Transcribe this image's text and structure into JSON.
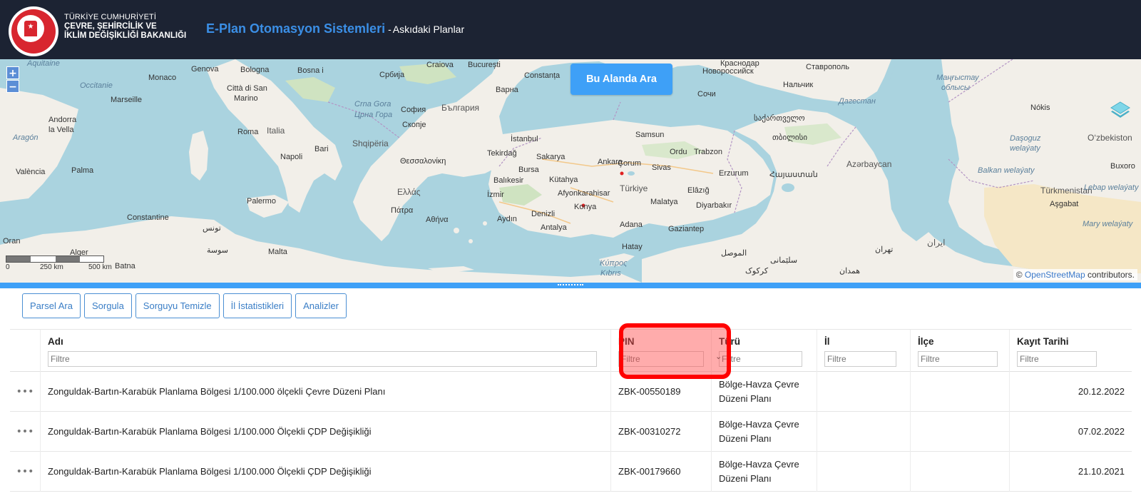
{
  "header": {
    "ministry_line1": "TÜRKİYE CUMHURİYETİ",
    "ministry_line2": "ÇEVRE, ŞEHİRCİLİK VE",
    "ministry_line3": "İKLİM DEĞİŞİKLİĞİ BAKANLIĞI",
    "app_title": "E-Plan Otomasyon Sistemleri",
    "separator": "-",
    "page_subtitle": "Askıdaki Planlar",
    "logo_icon": "ministry-seal-icon"
  },
  "map": {
    "search_area_label": "Bu Alanda Ara",
    "zoom_in": "+",
    "zoom_out": "−",
    "scale_labels": [
      "0",
      "250 km",
      "500 km"
    ],
    "attribution_prefix": "©",
    "attribution_link": "OpenStreetMap",
    "attribution_suffix": "contributors.",
    "labels": {
      "genova": "Genova",
      "bologna": "Bologna",
      "bosna": "Bosna i",
      "srbija": "Србија",
      "craiova": "Craiova",
      "bucuresti": "București",
      "constanta": "Constanța",
      "monaco": "Monaco",
      "citta": "Città di San",
      "marino": "Marino",
      "crnagora": "Crna Gora",
      "crnagora2": "Црна Гора",
      "sofiya": "София",
      "bulgaria": "България",
      "varna": "Варна",
      "andorra": "Andorra",
      "lavella": "la Vella",
      "marseille": "Marseille",
      "roma": "Roma",
      "italia": "Italia",
      "skopje": "Скопје",
      "shqiperia": "Shqipëria",
      "istanbul": "İstanbul",
      "samsun": "Samsun",
      "thess": "Θεσσαλονίκη",
      "tekirdag": "Tekirdağ",
      "sakarya": "Sakarya",
      "ankara": "Ankara",
      "corum": "Çorum",
      "ordu": "Ordu",
      "trabzon": "Trabzon",
      "bursa": "Bursa",
      "kutahya": "Kütahya",
      "sivas": "Sivas",
      "balikesir": "Balıkesir",
      "ellas": "Ελλάς",
      "izmir": "İzmir",
      "afyon": "Afyonkarahisar",
      "turkiye": "Türkiye",
      "erzurum": "Erzurum",
      "valencia": "València",
      "palma": "Palma",
      "bari": "Bari",
      "napoli": "Napoli",
      "patra": "Πάτρα",
      "athina": "Αθήνα",
      "aydin": "Aydın",
      "denizli": "Denizli",
      "konya": "Konya",
      "malatya": "Malatya",
      "diyarbakir": "Diyarbakır",
      "elazig": "Elâzığ",
      "antalya": "Antalya",
      "adana": "Adana",
      "gaziantep": "Gaziantep",
      "hatay": "Hatay",
      "kypros": "Κύπρος",
      "kibris": "Kıbrıs",
      "palermo": "Palermo",
      "constantine": "Constantine",
      "alger": "Alger",
      "oran": "Oran",
      "tunis": "تونس",
      "batna": "Batna",
      "malta": "Malta",
      "sousse": "سوسة",
      "sochi": "Сочи",
      "nalchik": "Нальчик",
      "sakartvelo": "საქართველო",
      "tbilisi": "თბილისი",
      "azerbaycan": "Azərbaycan",
      "hayastan": "Հայաստան",
      "novo": "Новороссийск",
      "krasnodar": "Краснодар",
      "stavropol": "Ставрополь",
      "dagestan": "Дагестан",
      "mangystau": "Маңғыстау",
      "oblysy": "облысы",
      "nokis": "Nókis",
      "ozbekiston": "O‘zbekiston",
      "dasoguz": "Daşoguz",
      "welayaty": "welaýaty",
      "balkan": "Balkan welaýaty",
      "turkmenistan": "Türkmenistan",
      "buxoro": "Buxoro",
      "lebap": "Lebap welaýaty",
      "asgabat": "Aşgabat",
      "mary": "Mary welaýaty",
      "aragon": "Aragón",
      "occitanie": "Occitanie",
      "aquitaine": "Aquitaine",
      "mosul": "الموصل",
      "sulaymaniya": "سلێمانی",
      "tehran": "تهران",
      "iran": "ایران",
      "kirkuk": "کرکوک",
      "hamadan": "همدان"
    }
  },
  "toolbar": {
    "parsel_ara": "Parsel Ara",
    "sorgula": "Sorgula",
    "sorguyu_temizle": "Sorguyu Temizle",
    "il_istatistikleri": "İl İstatistikleri",
    "analizler": "Analizler"
  },
  "table": {
    "columns": {
      "adi": "Adı",
      "pin": "PIN",
      "turu": "Türü",
      "il": "İl",
      "ilce": "İlçe",
      "kayit_tarihi": "Kayıt Tarihi"
    },
    "filter_placeholder": "Filtre",
    "row_menu_glyph": "•••",
    "rows": [
      {
        "adi": "Zonguldak-Bartın-Karabük Planlama Bölgesi 1/100.000 ölçekli Çevre Düzeni Planı",
        "pin": "ZBK-00550189",
        "turu_l1": "Bölge-Havza Çevre",
        "turu_l2": "Düzeni Planı",
        "il": "",
        "ilce": "",
        "tarih": "20.12.2022"
      },
      {
        "adi": "Zonguldak-Bartın-Karabük Planlama Bölgesi 1/100.000 Ölçekli ÇDP Değişikliği",
        "pin": "ZBK-00310272",
        "turu_l1": "Bölge-Havza Çevre",
        "turu_l2": "Düzeni Planı",
        "il": "",
        "ilce": "",
        "tarih": "07.02.2022"
      },
      {
        "adi": "Zonguldak-Bartın-Karabük Planlama Bölgesi 1/100.000 Ölçekli ÇDP Değişikliği",
        "pin": "ZBK-00179660",
        "turu_l1": "Bölge-Havza Çevre",
        "turu_l2": "Düzeni Planı",
        "il": "",
        "ilce": "",
        "tarih": "21.10.2021"
      }
    ]
  },
  "colors": {
    "header_bg": "#1c2333",
    "accent": "#3ea0f7",
    "highlight": "#ff0000"
  }
}
